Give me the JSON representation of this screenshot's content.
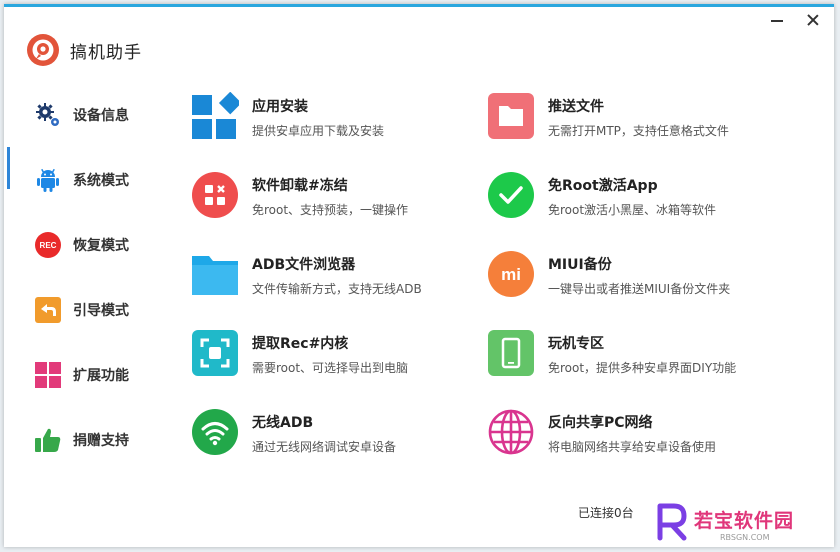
{
  "app": {
    "title": "搞机助手"
  },
  "sidebar": {
    "items": [
      {
        "label": "设备信息",
        "icon": "gear-icon"
      },
      {
        "label": "系统模式",
        "icon": "android-icon"
      },
      {
        "label": "恢复模式",
        "icon": "rec-icon",
        "icon_text": "REC"
      },
      {
        "label": "引导模式",
        "icon": "back-arrow-icon"
      },
      {
        "label": "扩展功能",
        "icon": "grid-icon"
      },
      {
        "label": "捐赠支持",
        "icon": "thumbs-up-icon"
      }
    ],
    "active_index": 1
  },
  "features": [
    {
      "title": "应用安装",
      "desc": "提供安卓应用下载及安装",
      "icon": "app-install-icon",
      "color": "#1a88d6"
    },
    {
      "title": "推送文件",
      "desc": "无需打开MTP，支持任意格式文件",
      "icon": "folder-icon",
      "color": "#f07077"
    },
    {
      "title": "软件卸载#冻结",
      "desc": "免root、支持预装，一键操作",
      "icon": "uninstall-icon",
      "color": "#ef4d4d"
    },
    {
      "title": "免Root激活App",
      "desc": "免root激活小黑屋、冰箱等软件",
      "icon": "checkmark-icon",
      "color": "#1dc94a"
    },
    {
      "title": "ADB文件浏览器",
      "desc": "文件传输新方式，支持无线ADB",
      "icon": "file-browser-icon",
      "color": "#1ea8e8"
    },
    {
      "title": "MIUI备份",
      "desc": "一键导出或者推送MIUI备份文件夹",
      "icon": "mi-icon",
      "color": "#f57f3a",
      "icon_text": "mi"
    },
    {
      "title": "提取Rec#内核",
      "desc": "需要root、可选择导出到电脑",
      "icon": "extract-icon",
      "color": "#20b9c9"
    },
    {
      "title": "玩机专区",
      "desc": "免root，提供多种安卓界面DIY功能",
      "icon": "phone-icon",
      "color": "#63c468"
    },
    {
      "title": "无线ADB",
      "desc": "通过无线网络调试安卓设备",
      "icon": "wifi-icon",
      "color": "#22a84a"
    },
    {
      "title": "反向共享PC网络",
      "desc": "将电脑网络共享给安卓设备使用",
      "icon": "globe-icon",
      "color": "#d9358f"
    }
  ],
  "status": {
    "text": "已连接0台"
  },
  "watermark": {
    "text": "若宝软件园",
    "sub": "RBSGN.COM",
    "letter": "R"
  }
}
